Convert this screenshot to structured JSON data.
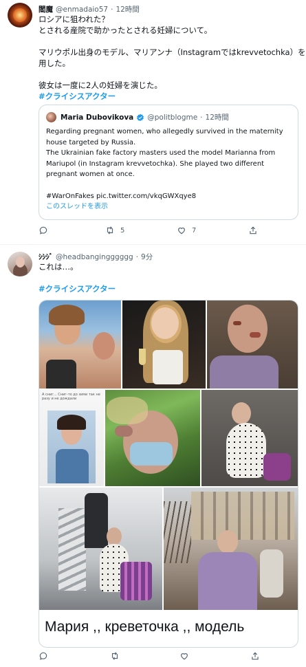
{
  "tweet1": {
    "display_name": "閻魔",
    "handle": "@enmadaio57",
    "separator": "·",
    "time": "12時間",
    "lines": [
      "ロシアに狙われた？",
      "とされる産院で助かったとされる妊婦について。",
      "",
      "マリウポル出身のモデル、マリアンナ（Instagramではkrevvetochka）を起",
      "用した。",
      "",
      "彼女は一度に2人の妊婦を演じた。"
    ],
    "hashtag": "#クライシスアクター",
    "quote": {
      "display_name": "Maria Dubovikova",
      "handle": "@politblogme",
      "time": "12時間",
      "lines": [
        "Regarding pregnant women, who allegedly survived in the maternity",
        "house targeted by Russia.",
        "The Ukrainian fake factory masters used the model Marianna from",
        "Mariupol (in Instagram krevvetochka). She played two different",
        "pregnant women at once.",
        "",
        "#WarOnFakes pic.twitter.com/vkqGWXqye8"
      ],
      "thread_link": "このスレッドを表示"
    },
    "actions": {
      "reply": "",
      "retweet": "5",
      "like": "7",
      "share": ""
    }
  },
  "tweet2": {
    "display_name": "ｼｼｼﾞ",
    "handle": "@headbangingggggg",
    "separator": "·",
    "time": "9分",
    "text": "これは…。",
    "hashtag": "#クライシスアクター",
    "media": {
      "photo_text_overlay": "А сниг... Сниг-то до зими так не разу и не дождали",
      "caption": "Мария ,, креветочка ,, модель",
      "caption2": "...."
    },
    "actions": {
      "reply": "",
      "retweet": "",
      "like": "",
      "share": ""
    }
  },
  "colors": {
    "link": "#1d9bf0",
    "secondary": "#536471",
    "border": "#cfd9de",
    "text": "#0f1419"
  }
}
